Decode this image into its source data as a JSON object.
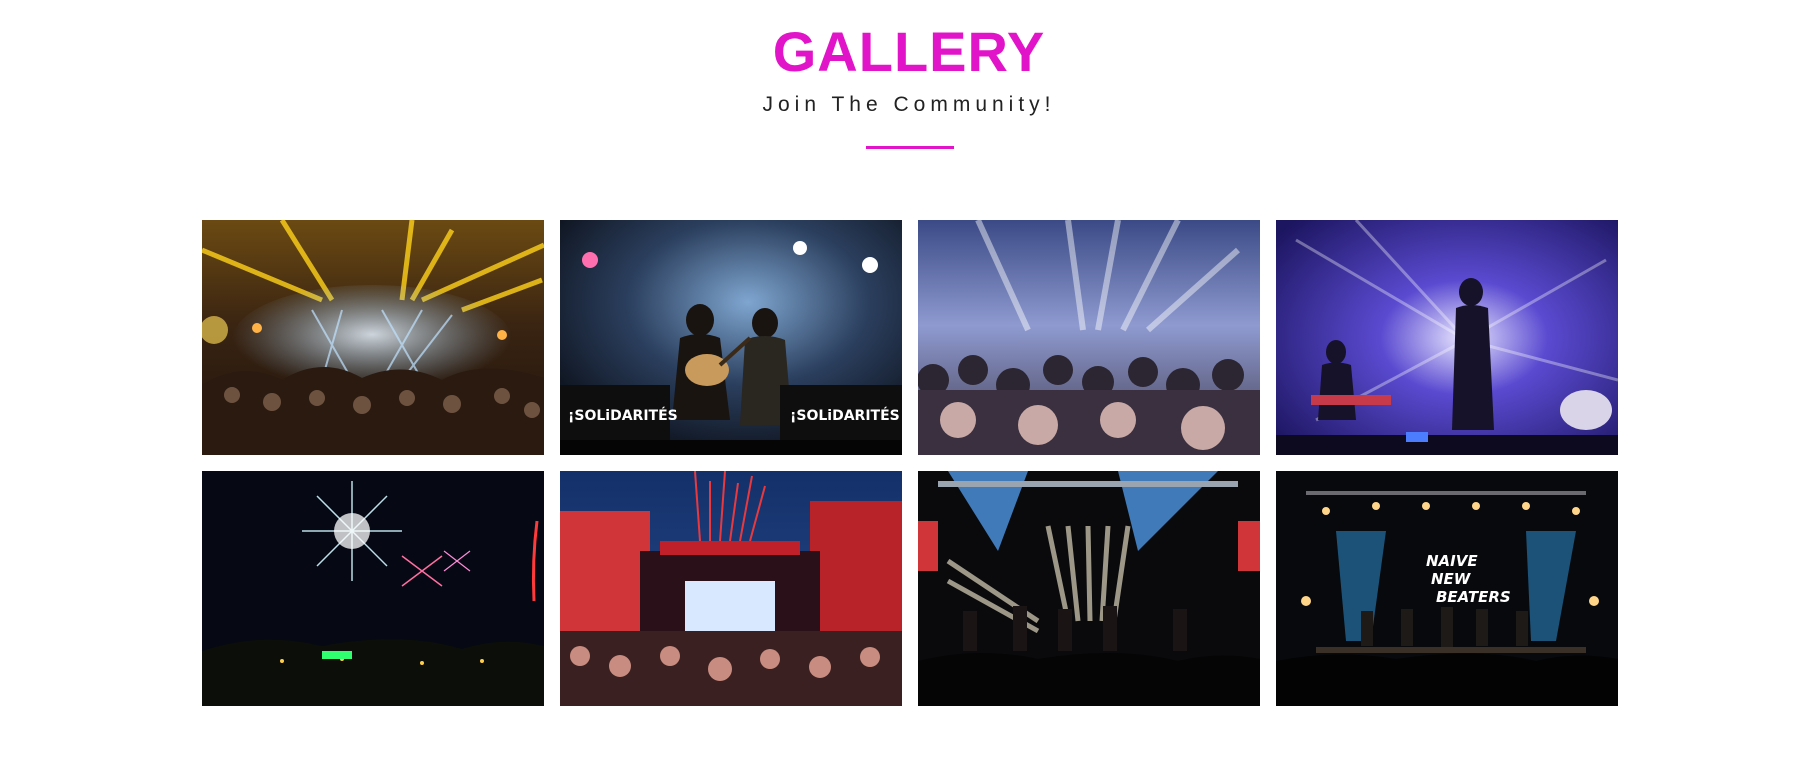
{
  "gallery": {
    "title": "GALLERY",
    "subtitle": "Join The Community!",
    "accent_color": "#e214c9",
    "banner_text": {
      "solidarites_left": "¡SOLiDARITÉS",
      "solidarites_right": "¡SOLiDARITÉS",
      "band_name_line1": "NAIVE",
      "band_name_line2": "NEW",
      "band_name_line3": "BEATERS"
    },
    "photos": [
      {
        "subject": "concert-crowd-yellow-lights"
      },
      {
        "subject": "duo-guitar-performance"
      },
      {
        "subject": "crowd-blue-stage-lights"
      },
      {
        "subject": "singer-purple-stage"
      },
      {
        "subject": "fireworks-night"
      },
      {
        "subject": "outdoor-festival-red-stage"
      },
      {
        "subject": "band-spotlight-stage"
      },
      {
        "subject": "band-dark-stage-logo"
      }
    ]
  }
}
